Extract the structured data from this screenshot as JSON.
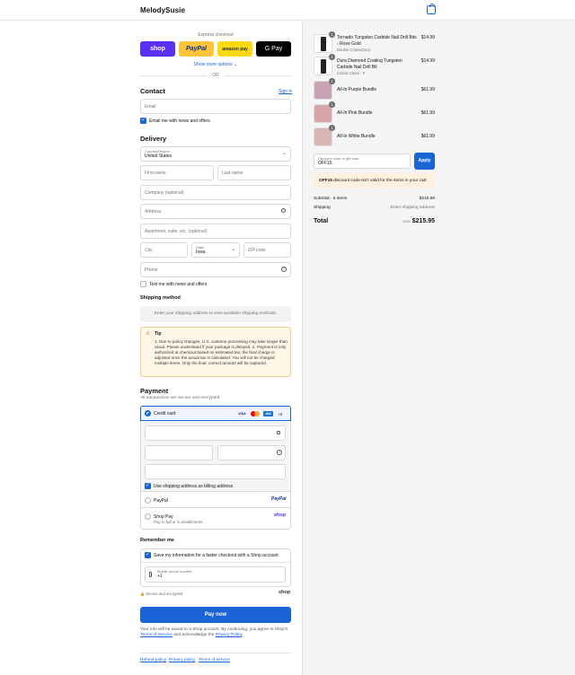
{
  "header": {
    "brand": "MelodySusie"
  },
  "express": {
    "label": "Express checkout",
    "buttons": [
      {
        "label": "shop",
        "bg": "#5a31f4",
        "fg": "#ffffff"
      },
      {
        "label": "PayPal",
        "bg": "#ffc439",
        "fg": "#003087"
      },
      {
        "label": "amazon pay",
        "bg": "#ffd814",
        "fg": "#232f3e"
      },
      {
        "label": "G Pay",
        "bg": "#000000",
        "fg": "#ffffff"
      }
    ],
    "more": "Show more options",
    "or": "OR"
  },
  "contact": {
    "title": "Contact",
    "signin": "Sign in",
    "email_placeholder": "Email",
    "news_label": "Email me with news and offers"
  },
  "delivery": {
    "title": "Delivery",
    "country_label": "Country/Region",
    "country_value": "United States",
    "first_name": "First name",
    "last_name": "Last name",
    "company": "Company (optional)",
    "address": "Address",
    "apartment": "Apartment, suite, etc. (optional)",
    "city": "City",
    "state_label": "State",
    "state_value": "Iowa",
    "zip": "ZIP code",
    "phone": "Phone",
    "text_label": "Text me with news and offers"
  },
  "shipping": {
    "title": "Shipping method",
    "placeholder": "Enter your shipping address to view available shipping methods."
  },
  "tip": {
    "title": "Tip",
    "body": "1. Due to policy changes, U.S. customs processing may take longer than usual. Please understand if your package is delayed. 2. Payment is only authorized at checkout based on estimated tax; the final charge is adjusted once the actual tax is calculated. You will not be charged multiple times. Only the final, correct amount will be captured."
  },
  "payment": {
    "title": "Payment",
    "subtitle": "All transactions are secure and encrypted.",
    "credit_card": "Credit card",
    "cards": [
      "VISA",
      "MC",
      "AMEX"
    ],
    "more_cards": "+3",
    "billing_label": "Use shipping address as billing address",
    "paypal": "PayPal",
    "paypal_logo": "PayPal",
    "shoppay": "Shop Pay",
    "shoppay_sub": "Pay in full or in installments",
    "shoppay_logo": "shop"
  },
  "remember": {
    "title": "Remember me",
    "save_label": "Save my information for a faster checkout with a Shop account",
    "phone_label": "Mobile phone number",
    "phone_value": "+1",
    "secure": "Secure and encrypted",
    "shop_logo": "shop"
  },
  "pay_now": "Pay now",
  "legal": {
    "text1": "Your info will be saved to a Shop account. By continuing, you agree to Shop's",
    "terms": "Terms of Service",
    "and": "and acknowledge the",
    "privacy": "Privacy Policy",
    "end": "."
  },
  "footer": {
    "refund": "Refund policy",
    "privacy": "Privacy policy",
    "terms": "Terms of service"
  },
  "order": {
    "items": [
      {
        "name": "Tornado Tungsten Carbide Nail Drill Bits - Rose Gold",
        "sub": "Double Coarse(3xc)",
        "price": "$14.99",
        "qty": "1",
        "thumb": "#222222"
      },
      {
        "name": "Dura Diamond Coating Tungsten Carbide Nail Drill Bit",
        "sub": "Cuticle Clean - F",
        "price": "$14.99",
        "qty": "1",
        "thumb": "#222222"
      },
      {
        "name": "All-In Purple Bundle",
        "sub": "",
        "price": "$61.99",
        "qty": "1",
        "thumb": "#c9a3b4"
      },
      {
        "name": "All-In Pink Bundle",
        "sub": "",
        "price": "$61.99",
        "qty": "1",
        "thumb": "#d9a6a8"
      },
      {
        "name": "All-In White Bundle",
        "sub": "",
        "price": "$61.99",
        "qty": "1",
        "thumb": "#d8b7b2"
      }
    ],
    "discount_label": "Discount code or gift card",
    "discount_value": "OFF15",
    "apply": "Apply",
    "discount_code": "OFF15",
    "discount_msg": "discount code isn't valid for the items in your cart",
    "subtotal_label": "Subtotal · 5 items",
    "subtotal_value": "$215.95",
    "shipping_label": "Shipping",
    "shipping_value": "Enter shipping address",
    "total_label": "Total",
    "currency": "USD",
    "total_value": "$215.95"
  },
  "colors": {
    "accent": "#1a64d6",
    "tip_bg": "#fff6e8",
    "error_bg": "#fff1e0"
  }
}
